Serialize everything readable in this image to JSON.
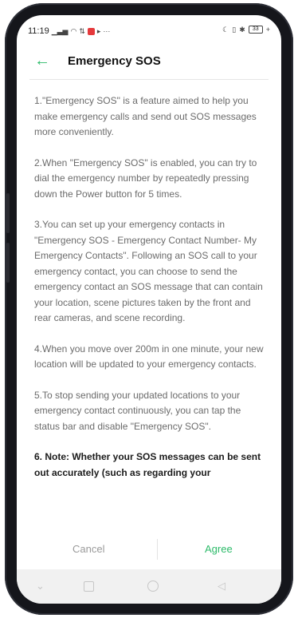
{
  "status_bar": {
    "time": "11:19",
    "left_icons": [
      "signal-icon",
      "signal-bars-icon",
      "wifi-icon",
      "data-icon",
      "notification-red-icon",
      "play-icon",
      "more-dots-icon"
    ],
    "battery_text": "33"
  },
  "header": {
    "title": "Emergency SOS"
  },
  "content": {
    "paragraphs": [
      "1.\"Emergency SOS\" is a feature aimed to help you make emergency calls and send out SOS messages more conveniently.",
      "2.When \"Emergency SOS\" is enabled, you can try to dial the emergency number by repeatedly pressing down the Power button for 5 times.",
      "3.You can set up your emergency contacts in \"Emergency SOS - Emergency Contact Number- My Emergency Contacts\". Following an SOS call to your emergency contact, you can choose to send the emergency contact an SOS message that can contain your location, scene pictures taken by the front and rear cameras, and scene recording.",
      "4.When you move over 200m in one minute, your new location will be updated to your emergency contacts.",
      "5.To stop sending your updated locations to your emergency contact continuously, you can tap the status bar and disable \"Emergency SOS\"."
    ],
    "note": "6. Note: Whether your SOS messages can be sent out accurately (such as regarding your"
  },
  "actions": {
    "cancel": "Cancel",
    "agree": "Agree"
  },
  "colors": {
    "accent": "#2dbb6a",
    "text": "#6b6b6b",
    "title": "#111111"
  }
}
